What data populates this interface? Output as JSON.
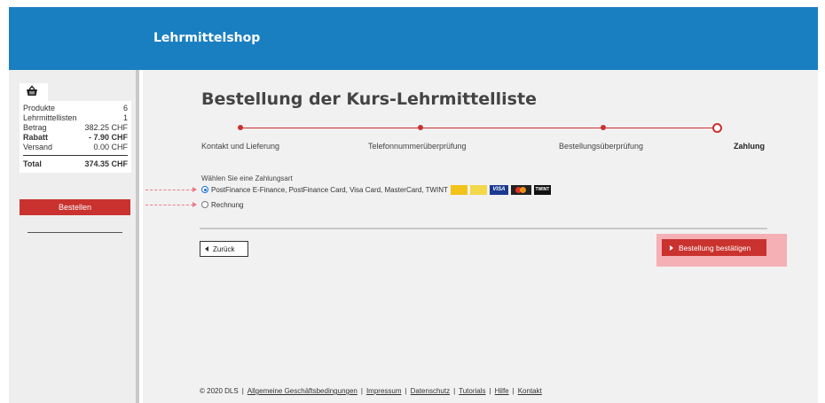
{
  "header": {
    "brand": "Lehrmittelshop"
  },
  "cart": {
    "icon": "basket-icon",
    "rows": [
      {
        "label": "Produkte",
        "value": "6",
        "bold": false
      },
      {
        "label": "Lehrmittellisten",
        "value": "1",
        "bold": false
      },
      {
        "label": "Betrag",
        "value": "382.25 CHF",
        "bold": false
      },
      {
        "label": "Rabatt",
        "value": "- 7.90 CHF",
        "bold": true
      },
      {
        "label": "Versand",
        "value": "0.00 CHF",
        "bold": false
      }
    ],
    "total_label": "Total",
    "total_value": "374.35 CHF",
    "order_button": "Bestellen"
  },
  "page": {
    "title": "Bestellung der Kurs-Lehrmittelliste"
  },
  "steps": [
    {
      "label": "Kontakt und Lieferung",
      "active": false
    },
    {
      "label": "Telefonnummerüberprüfung",
      "active": false
    },
    {
      "label": "Bestellungsüberprüfung",
      "active": false
    },
    {
      "label": "Zahlung",
      "active": true
    }
  ],
  "payment": {
    "heading": "Wählen Sie eine Zahlungsart",
    "options": [
      {
        "label": "PostFinance E-Finance, PostFinance Card, Visa Card, MasterCard, TWINT",
        "selected": true,
        "logos": [
          "VISA",
          "TWINT"
        ]
      },
      {
        "label": "Rechnung",
        "selected": false
      }
    ]
  },
  "actions": {
    "back": "Zurück",
    "confirm": "Bestellung bestätigen"
  },
  "footer": {
    "copyright": "© 2020 DLS",
    "links": [
      "Allgemeine Geschäftsbedingungen",
      "Impressum",
      "Datenschutz",
      "Tutorials",
      "Hilfe",
      "Kontakt"
    ]
  },
  "colors": {
    "brand_blue": "#1a7fc1",
    "accent_red": "#c9322e",
    "highlight_pink": "#f4b0b5"
  }
}
